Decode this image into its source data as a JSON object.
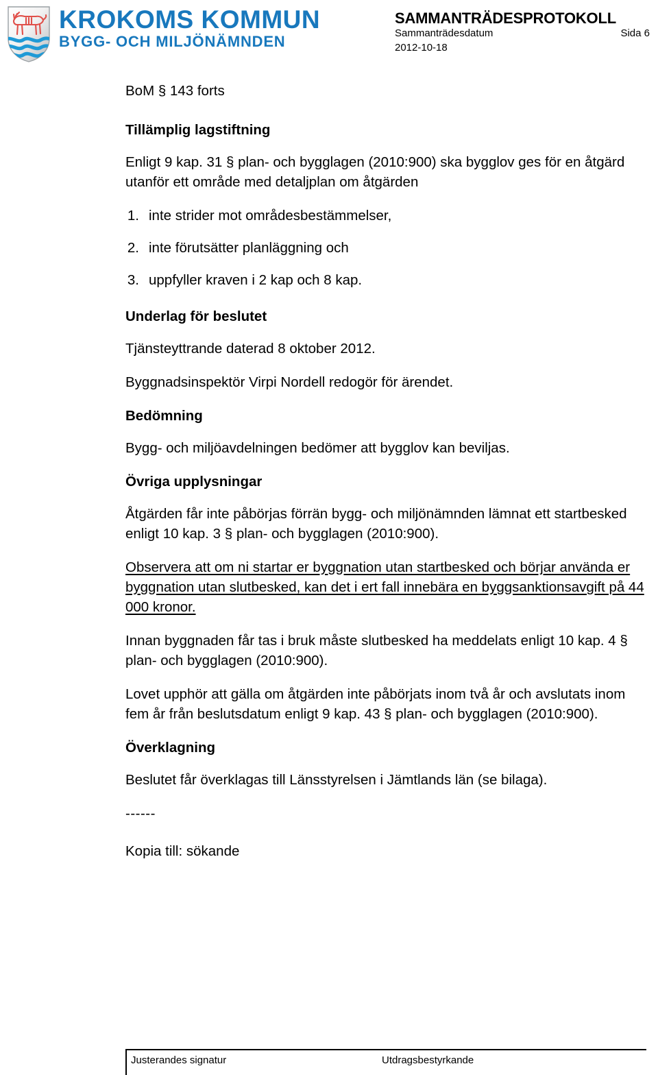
{
  "header": {
    "logo": {
      "crest_icon": "krokoms-coat-of-arms-icon",
      "municipality": "KROKOMS KOMMUN",
      "committee": "BYGG- OCH MILJÖNÄMNDEN",
      "brand_color": "#1878bd",
      "crest_elk_color": "#e0504a",
      "crest_wave_color": "#1f9ad6"
    },
    "document_type": "SAMMANTRÄDESPROTOKOLL",
    "meeting_date_label": "Sammanträdesdatum",
    "page_label": "Sida 6",
    "meeting_date": "2012-10-18"
  },
  "body": {
    "case_id": "BoM § 143 forts",
    "heading_legislation": "Tillämplig lagstiftning",
    "intro_paragraph": "Enligt 9 kap. 31 § plan- och bygglagen (2010:900) ska bygglov ges för en åtgärd utanför ett område med detaljplan om åtgärden",
    "conditions": [
      {
        "num": "1.",
        "text": "inte strider mot områdesbestämmelser,"
      },
      {
        "num": "2.",
        "text": "inte förutsätter planläggning och"
      },
      {
        "num": "3.",
        "text": "uppfyller kraven i 2 kap och 8 kap."
      }
    ],
    "heading_basis": "Underlag för beslutet",
    "basis_paragraph_1": "Tjänsteyttrande daterad 8 oktober 2012.",
    "basis_paragraph_2": "Byggnadsinspektör Virpi Nordell redogör för ärendet.",
    "heading_assessment": "Bedömning",
    "assessment_paragraph": "Bygg- och miljöavdelningen bedömer att bygglov kan beviljas.",
    "heading_other_info": "Övriga upplysningar",
    "other_paragraph_1": "Åtgärden får inte påbörjas förrän bygg- och miljönämnden lämnat ett startbesked enligt 10 kap. 3 § plan- och bygglagen (2010:900).",
    "other_paragraph_underlined": "Observera att om ni startar er byggnation utan startbesked och börjar använda er byggnation utan slutbesked, kan det i ert fall innebära en byggsanktionsavgift på 44 000 kronor.",
    "other_paragraph_2": "Innan byggnaden får tas i bruk måste slutbesked ha meddelats enligt 10 kap. 4 § plan- och bygglagen (2010:900).",
    "other_paragraph_3": "Lovet upphör att gälla om åtgärden inte påbörjats inom två år och avslutats inom fem år från beslutsdatum enligt 9 kap. 43 § plan- och bygglagen (2010:900).",
    "heading_appeal": "Överklagning",
    "appeal_paragraph": "Beslutet får överklagas till Länsstyrelsen i Jämtlands län (se bilaga).",
    "separator": "------",
    "copy_to": "Kopia till:  sökande"
  },
  "footer": {
    "signature_label": "Justerandes signatur",
    "certification_label": "Utdragsbestyrkande"
  }
}
